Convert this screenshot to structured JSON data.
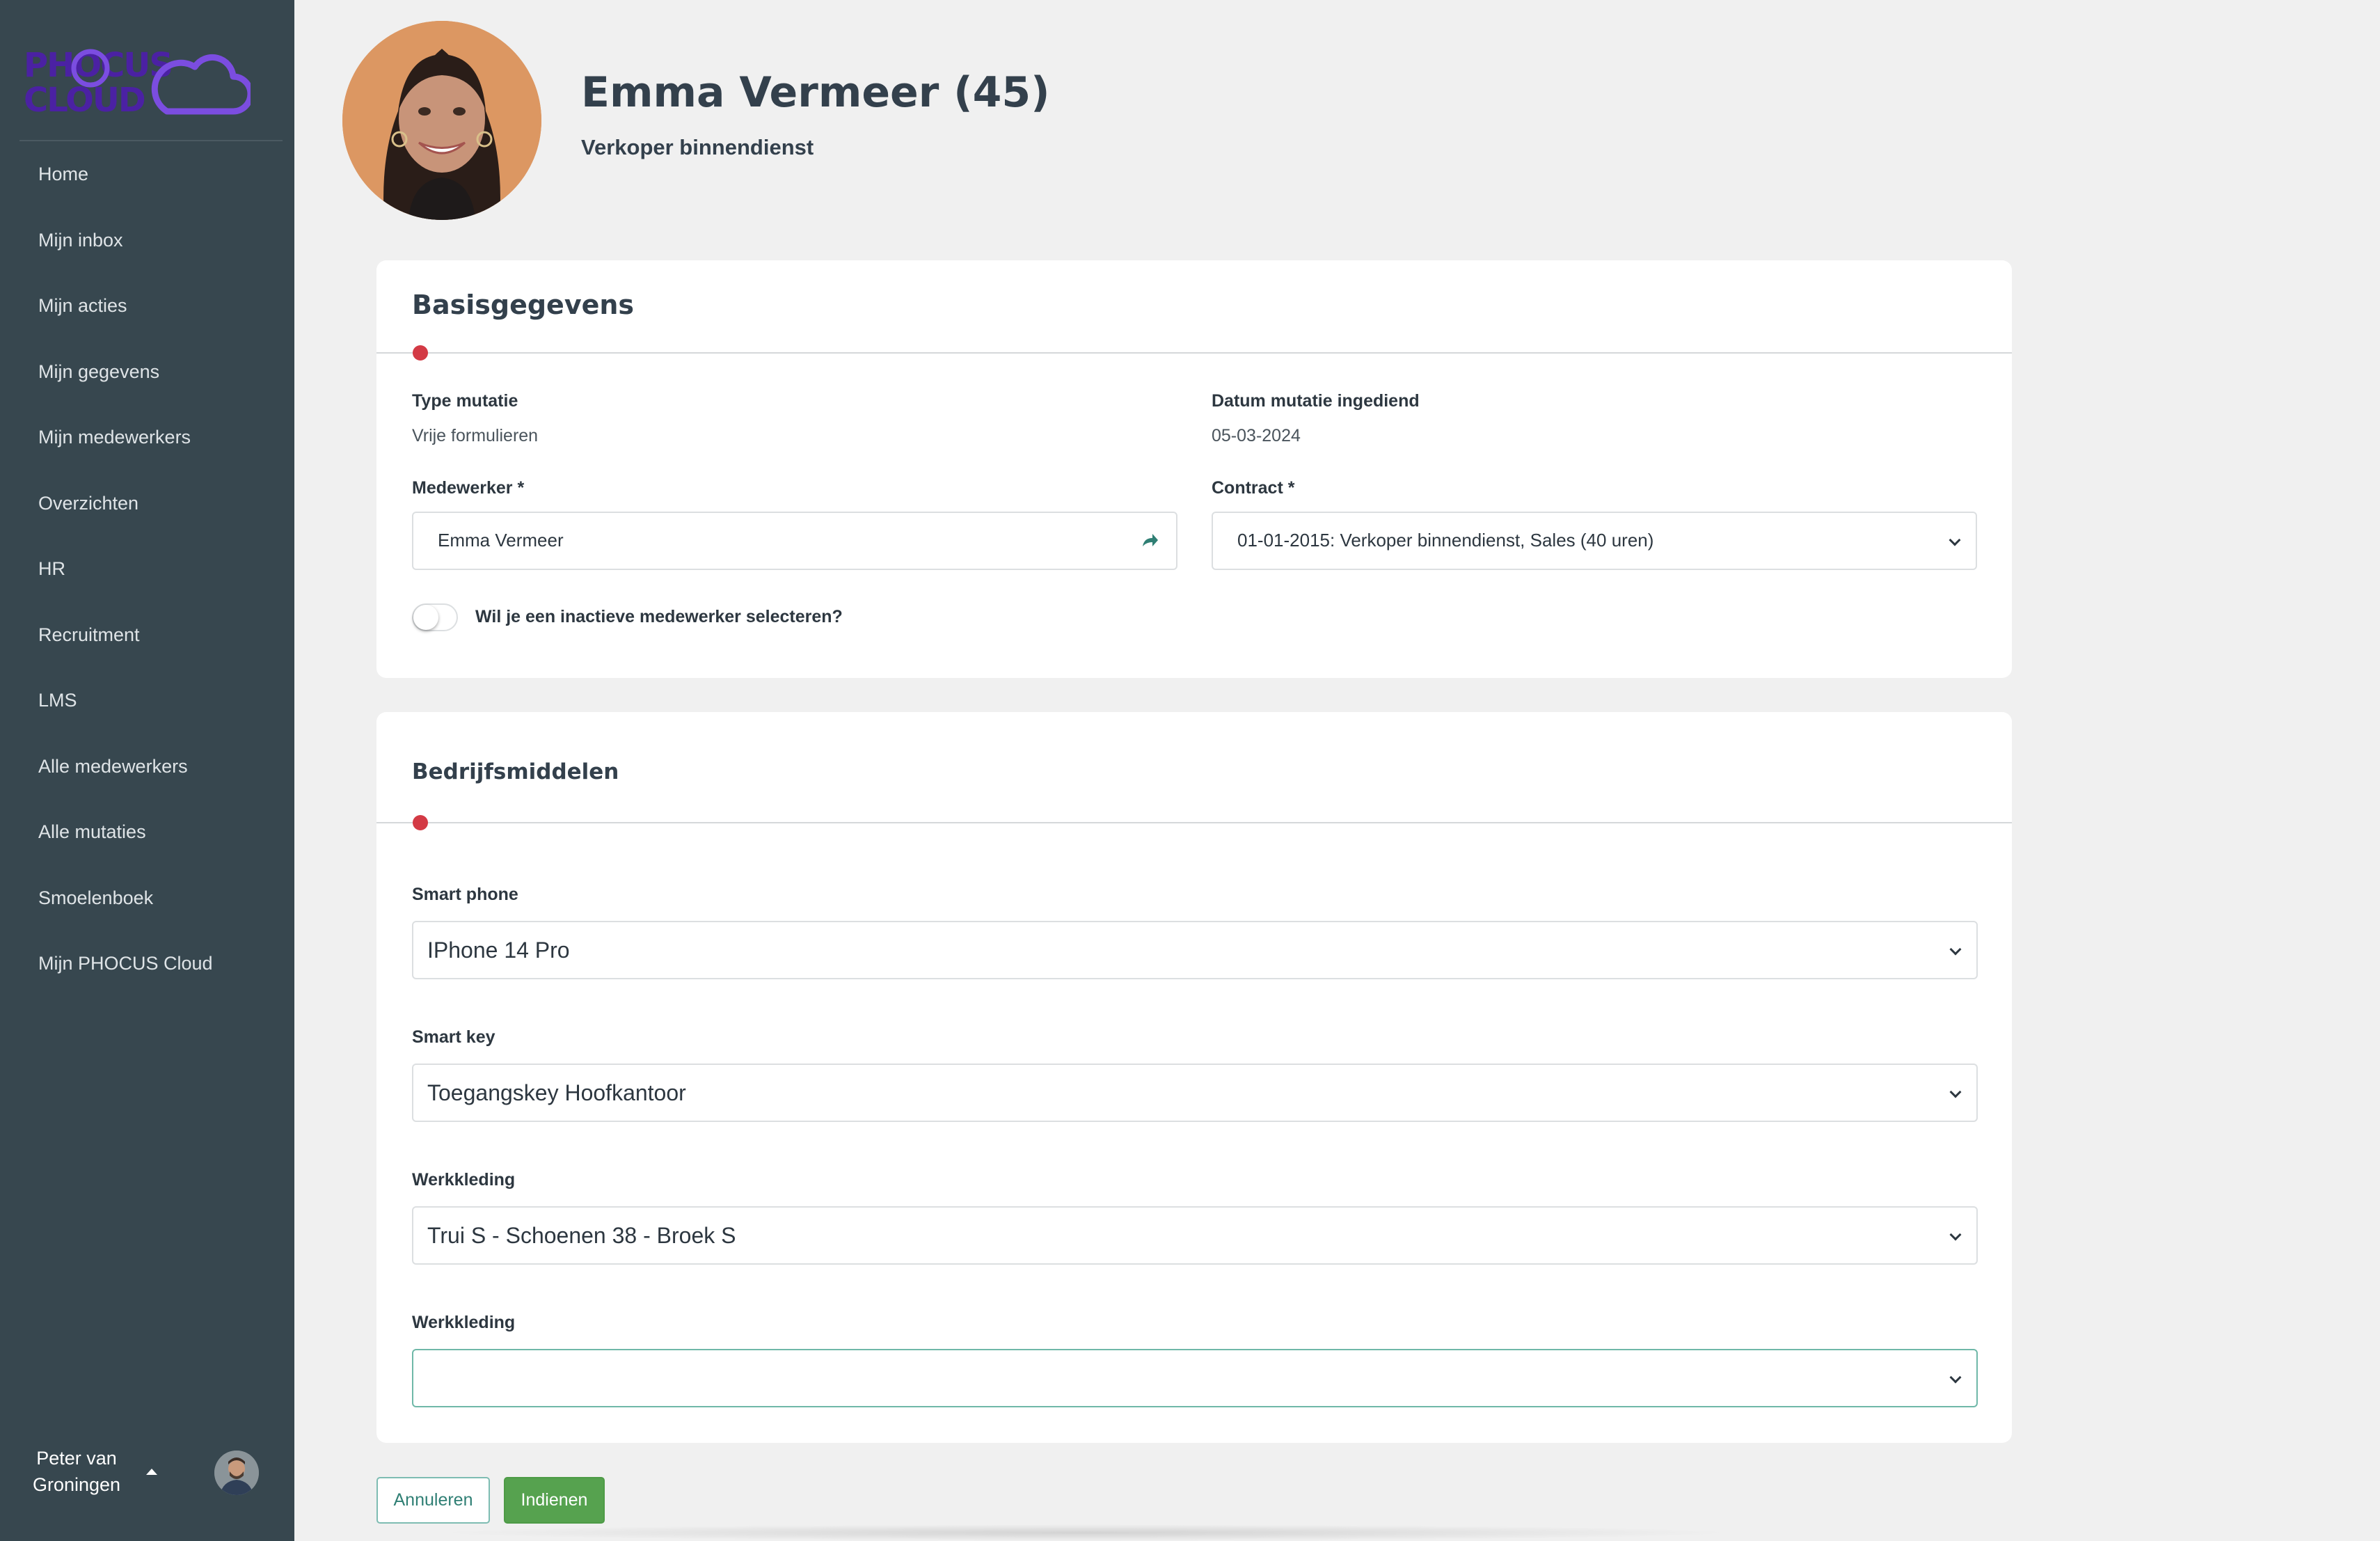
{
  "app": {
    "logo_text": "PHOCUS CLOUD",
    "brand_color": "#4b21a3",
    "accent_purple": "#7b4de0"
  },
  "sidebar": {
    "items": [
      {
        "label": "Home"
      },
      {
        "label": "Mijn inbox"
      },
      {
        "label": "Mijn acties"
      },
      {
        "label": "Mijn gegevens"
      },
      {
        "label": "Mijn medewerkers"
      },
      {
        "label": "Overzichten"
      },
      {
        "label": "HR"
      },
      {
        "label": "Recruitment"
      },
      {
        "label": "LMS"
      },
      {
        "label": "Alle medewerkers"
      },
      {
        "label": "Alle mutaties"
      },
      {
        "label": "Smoelenboek"
      },
      {
        "label": "Mijn PHOCUS Cloud"
      }
    ],
    "user": {
      "name": "Peter van Groningen",
      "caret_icon": "caret-up-icon"
    }
  },
  "header": {
    "name": "Emma Vermeer (45)",
    "role": "Verkoper binnendienst"
  },
  "basis": {
    "title": "Basisgegevens",
    "type_label": "Type mutatie",
    "type_value": "Vrije formulieren",
    "date_label": "Datum mutatie ingediend",
    "date_value": "05-03-2024",
    "employee_label": "Medewerker *",
    "employee_value": "Emma Vermeer",
    "employee_icon": "share-arrow-icon",
    "contract_label": "Contract *",
    "contract_value": "01-01-2015: Verkoper binnendienst, Sales (40 uren)",
    "inactive_toggle_label": "Wil je een inactieve medewerker selecteren?",
    "inactive_toggle_on": false
  },
  "bedrijfsmiddelen": {
    "title": "Bedrijfsmiddelen",
    "fields": [
      {
        "label": "Smart phone",
        "value": "IPhone 14 Pro"
      },
      {
        "label": "Smart key",
        "value": "Toegangskey Hoofkantoor"
      },
      {
        "label": "Werkkleding",
        "value": "Trui S - Schoenen 38 - Broek S"
      },
      {
        "label": "Werkkleding",
        "value": ""
      }
    ]
  },
  "actions": {
    "cancel_label": "Annuleren",
    "submit_label": "Indienen",
    "submit_color": "#56a24f",
    "required_dot_color": "#d33a45"
  }
}
